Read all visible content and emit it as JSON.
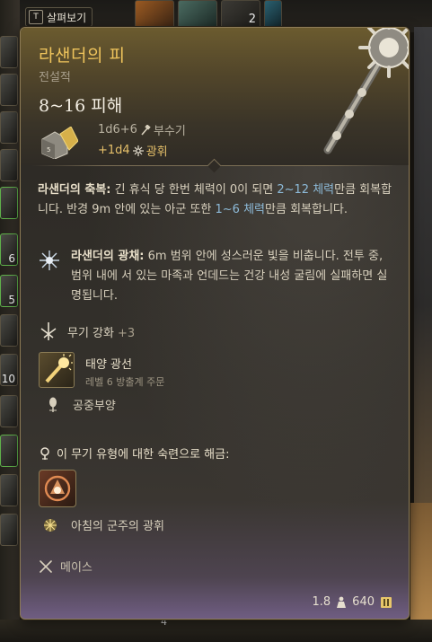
{
  "top_bar": {
    "browse_key": "T",
    "browse_label": "살펴보기",
    "slot_count": "2"
  },
  "left_hotbar": {
    "slot_numbers": [
      "6",
      "5",
      "10"
    ]
  },
  "bottom_bar": {
    "number": "4"
  },
  "item": {
    "name": "라샌더의 피",
    "rarity": "전설적",
    "damage": "8~16 피해",
    "damage_dice": "1d6+6",
    "damage_type": "부수기",
    "bonus_dice": "+1d4",
    "bonus_type": "광휘",
    "blessing": {
      "title": "라샌더의 축복:",
      "text_1": " 긴 휴식 당 한번 체력이 0이 되면 ",
      "hl_1": "2~12 체력",
      "text_2": "만큼 회복합니다. 반경 9m 안에 있는 아군 또한 ",
      "hl_2": "1~6 체력",
      "text_3": "만큼 회복합니다."
    },
    "radiance": {
      "title": "라샌더의 광채:",
      "text": " 6m 범위 안에 성스러운 빛을 비춥니다. 전투 중, 범위 내에 서 있는 마족과 언데드는 건강 내성 굴림에 실패하면 실명됩니다."
    },
    "enchantment": {
      "label": "무기 강화",
      "value": "+3"
    },
    "spell": {
      "name": "태양 광선",
      "detail": "레벨 6 방출계 주문"
    },
    "property": "공중부양",
    "proficiency_unlock": "이 무기 유형에 대한 숙련으로 해금:",
    "proficiency_action": "아침의 군주의 광휘",
    "weapon_type": "메이스",
    "weight": "1.8",
    "price": "640"
  },
  "colors": {
    "legendary_name": "#efc45c",
    "highlight_blue": "#8dbad8",
    "bonus_gold": "#e6c06a"
  },
  "icons": [
    "dice-icon",
    "hammer-icon",
    "radiant-icon",
    "radiance-burst-icon",
    "enchant-icon",
    "sun-spell-icon",
    "feather-icon",
    "proficiency-lock-icon",
    "proficiency-action-icon",
    "sunburst-icon",
    "crossed-maces-icon",
    "weight-icon",
    "coin-icon",
    "mace-artwork-icon"
  ]
}
